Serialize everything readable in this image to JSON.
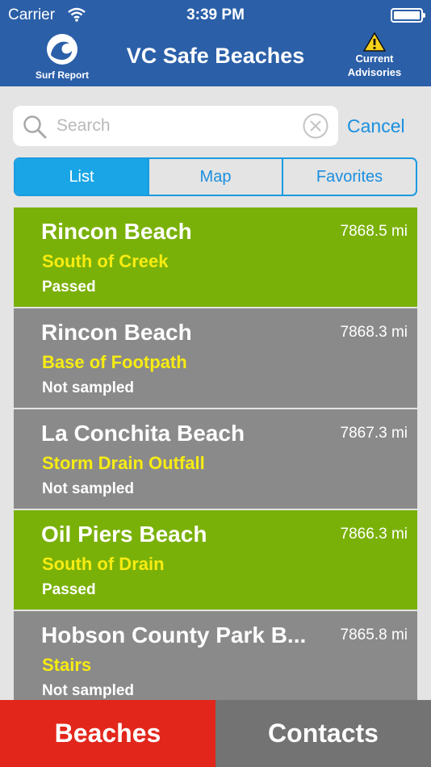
{
  "status_bar": {
    "carrier": "Carrier",
    "time": "3:39 PM"
  },
  "nav": {
    "title": "VC Safe Beaches",
    "surf_report_label": "Surf Report",
    "advisories_line1": "Current",
    "advisories_line2": "Advisories"
  },
  "search": {
    "placeholder": "Search",
    "value": "",
    "cancel_label": "Cancel"
  },
  "segments": {
    "list": "List",
    "map": "Map",
    "favorites": "Favorites",
    "selected": "List"
  },
  "beaches": [
    {
      "name": "Rincon Beach",
      "location": "South of Creek",
      "status": "Passed",
      "distance": "7868.5 mi"
    },
    {
      "name": "Rincon Beach",
      "location": "Base of Footpath",
      "status": "Not sampled",
      "distance": "7868.3 mi"
    },
    {
      "name": "La Conchita Beach",
      "location": "Storm Drain Outfall",
      "status": "Not sampled",
      "distance": "7867.3 mi"
    },
    {
      "name": "Oil Piers Beach",
      "location": "South of Drain",
      "status": "Passed",
      "distance": "7866.3 mi"
    },
    {
      "name": "Hobson County Park B...",
      "location": "Stairs",
      "status": "Not sampled",
      "distance": "7865.8 mi"
    }
  ],
  "tabs": {
    "beaches": "Beaches",
    "contacts": "Contacts",
    "selected": "Beaches"
  },
  "colors": {
    "header": "#2b5fa8",
    "passed": "#7ab108",
    "not_sampled": "#8a8a8a",
    "location_text": "#f7ec12",
    "accent": "#1b8fe0",
    "tab_active": "#e3261b",
    "tab_inactive": "#737373"
  }
}
